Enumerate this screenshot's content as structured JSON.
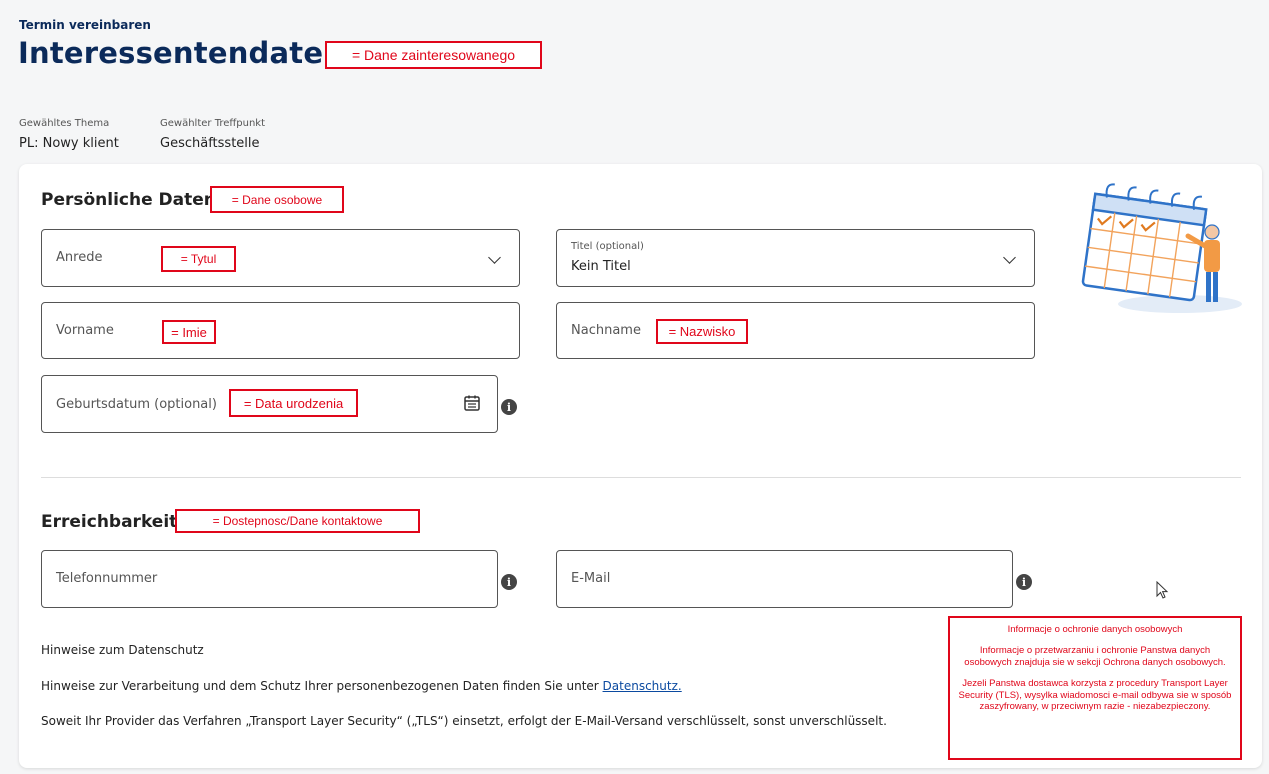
{
  "header": {
    "kicker": "Termin vereinbaren",
    "title": "Interessentendaten",
    "title_annotation": "= Dane zainteresowanego"
  },
  "meta": {
    "topic_label": "Gewähltes Thema",
    "topic_value": "PL: Nowy klient",
    "meeting_label": "Gewählter Treffpunkt",
    "meeting_value": "Geschäftsstelle"
  },
  "personal": {
    "heading": "Persönliche Daten",
    "heading_annotation": "= Dane osobowe",
    "salutation_label": "Anrede",
    "salutation_annotation": "= Tytul",
    "title_label": "Titel (optional)",
    "title_value": "Kein Titel",
    "firstname_label": "Vorname",
    "firstname_annotation": "= Imie",
    "lastname_label": "Nachname",
    "lastname_annotation": "= Nazwisko",
    "birthdate_label": "Geburtsdatum (optional)",
    "birthdate_annotation": "= Data urodzenia"
  },
  "contact": {
    "heading": "Erreichbarkeit",
    "heading_annotation": "= Dostepnosc/Dane kontaktowe",
    "phone_label": "Telefonnummer",
    "email_label": "E-Mail"
  },
  "privacy": {
    "heading": "Hinweise zum Datenschutz",
    "line1_prefix": "Hinweise zur Verarbeitung und dem Schutz Ihrer personenbezogenen Daten finden Sie unter ",
    "line1_link": "Datenschutz.",
    "line2": "Soweit Ihr Provider das Verfahren „Transport Layer Security“ („TLS“) einsetzt, erfolgt der E-Mail-Versand verschlüsselt, sonst unverschlüsselt."
  },
  "privacy_annotation": {
    "title": "Informacje o ochronie danych osobowych",
    "para1": "Informacje o przetwarzaniu i ochronie Panstwa danych osobowych znajduja sie w sekcji Ochrona danych osobowych.",
    "para2": "Jezeli Panstwa dostawca korzysta z procedury Transport Layer Security (TLS), wysylka wiadomosci e-mail odbywa sie w sposób zaszyfrowany, w przeciwnym razie - niezabezpieczony."
  },
  "icons": {
    "info": "info-icon",
    "calendar": "calendar-icon",
    "chevron": "chevron-down-icon",
    "illustration": "calendar-illustration"
  },
  "colors": {
    "brand_navy": "#0b2a5a",
    "annotation_red": "#e0061a",
    "link_blue": "#0b4aa0"
  }
}
